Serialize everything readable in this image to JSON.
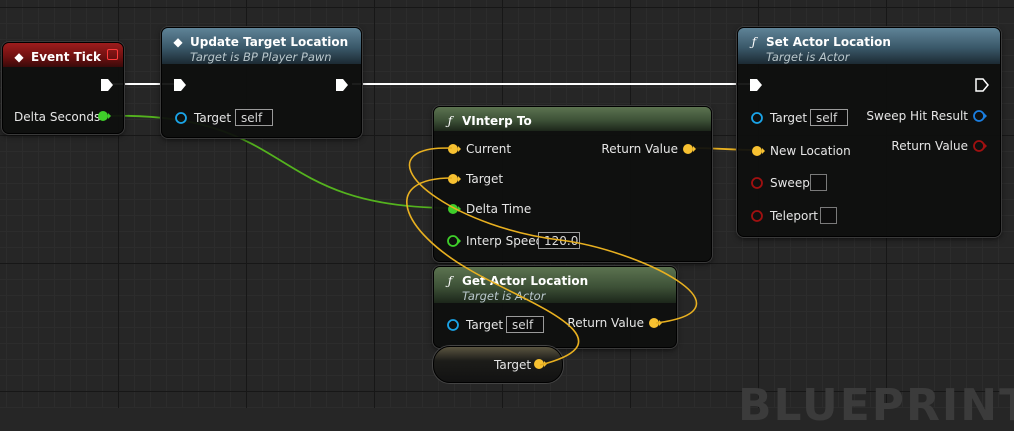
{
  "watermark": "BLUEPRINT",
  "colors": {
    "exec": "#ffffff",
    "float": "#9ff51d",
    "vector": "#f7c131",
    "object": "#1aa4e8",
    "bool": "#8b0b0b",
    "event_header": "#8b1a1a",
    "function_header": "#44667a",
    "pure_header": "#45603f"
  },
  "nodes": {
    "event_tick": {
      "title": "Event Tick",
      "icon": "event-diamond-icon",
      "pins": {
        "delta_seconds": "Delta Seconds"
      }
    },
    "update_target": {
      "title": "Update Target Location",
      "subtitle": "Target is BP Player Pawn",
      "icon": "event-diamond-icon",
      "pins": {
        "target": "Target",
        "target_value": "self"
      }
    },
    "set_actor_location": {
      "title": "Set Actor Location",
      "subtitle": "Target is Actor",
      "icon": "function-icon",
      "pins": {
        "target": "Target",
        "target_value": "self",
        "new_location": "New Location",
        "sweep": "Sweep",
        "teleport": "Teleport",
        "sweep_hit_result": "Sweep Hit Result",
        "return_value": "Return Value"
      }
    },
    "vinterp_to": {
      "title": "VInterp To",
      "icon": "function-icon",
      "pins": {
        "current": "Current",
        "target": "Target",
        "delta_time": "Delta Time",
        "interp_speed": "Interp Speed",
        "interp_speed_value": "120.0",
        "return_value": "Return Value"
      }
    },
    "get_actor_location": {
      "title": "Get Actor Location",
      "subtitle": "Target is Actor",
      "icon": "function-icon",
      "pins": {
        "target": "Target",
        "target_value": "self",
        "return_value": "Return Value"
      }
    },
    "target_variable": {
      "label": "Target"
    }
  }
}
